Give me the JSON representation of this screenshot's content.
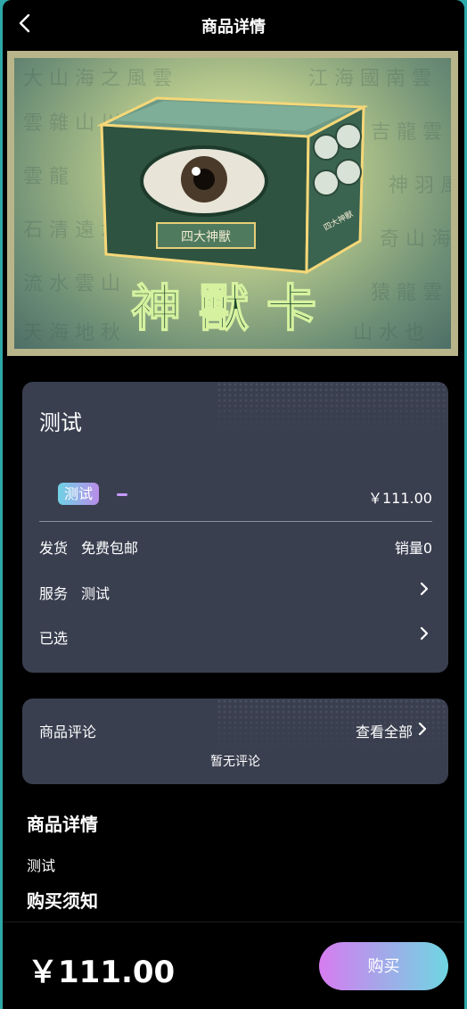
{
  "header": {
    "title": "商品详情"
  },
  "hero": {
    "banner_text": "神獸卡",
    "box_label": "四大神獸",
    "box_side_label": "四大神獸"
  },
  "product": {
    "name": "测试",
    "tag": "测试",
    "price": "￥111.00"
  },
  "info_rows": {
    "shipping_label": "发货",
    "shipping_value": "免费包邮",
    "sales": "销量0",
    "service_label": "服务",
    "service_value": "测试",
    "selected_label": "已选"
  },
  "reviews": {
    "title": "商品评论",
    "view_all": "查看全部",
    "empty": "暂无评论"
  },
  "details": {
    "title": "商品详情",
    "text": "测试",
    "notice_title": "购买须知"
  },
  "footer": {
    "price": "￥111.00",
    "buy_label": "购买"
  },
  "colors": {
    "card_bg": "#3a3f50",
    "accent_gradient_start": "#d67cf0",
    "accent_gradient_end": "#6fd6e2"
  }
}
